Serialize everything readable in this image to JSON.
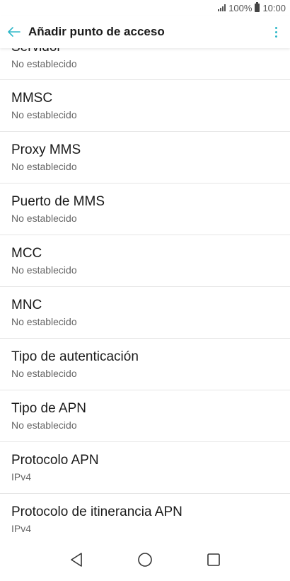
{
  "status_bar": {
    "battery_text": "100%",
    "time": "10:00"
  },
  "app_bar": {
    "title": "Añadir punto de acceso",
    "accent_color": "#2fb8c9"
  },
  "settings": [
    {
      "title": "Servidor",
      "value": "No establecido"
    },
    {
      "title": "MMSC",
      "value": "No establecido"
    },
    {
      "title": "Proxy MMS",
      "value": "No establecido"
    },
    {
      "title": "Puerto de MMS",
      "value": "No establecido"
    },
    {
      "title": "MCC",
      "value": "No establecido"
    },
    {
      "title": "MNC",
      "value": "No establecido"
    },
    {
      "title": "Tipo de autenticación",
      "value": "No establecido"
    },
    {
      "title": "Tipo de APN",
      "value": "No establecido"
    },
    {
      "title": "Protocolo APN",
      "value": "IPv4"
    },
    {
      "title": "Protocolo de itinerancia APN",
      "value": "IPv4"
    }
  ],
  "icons": {
    "back": "arrow-left-icon",
    "menu": "more-vert-icon",
    "nav_back": "triangle-back-icon",
    "nav_home": "circle-home-icon",
    "nav_recents": "square-recents-icon"
  }
}
